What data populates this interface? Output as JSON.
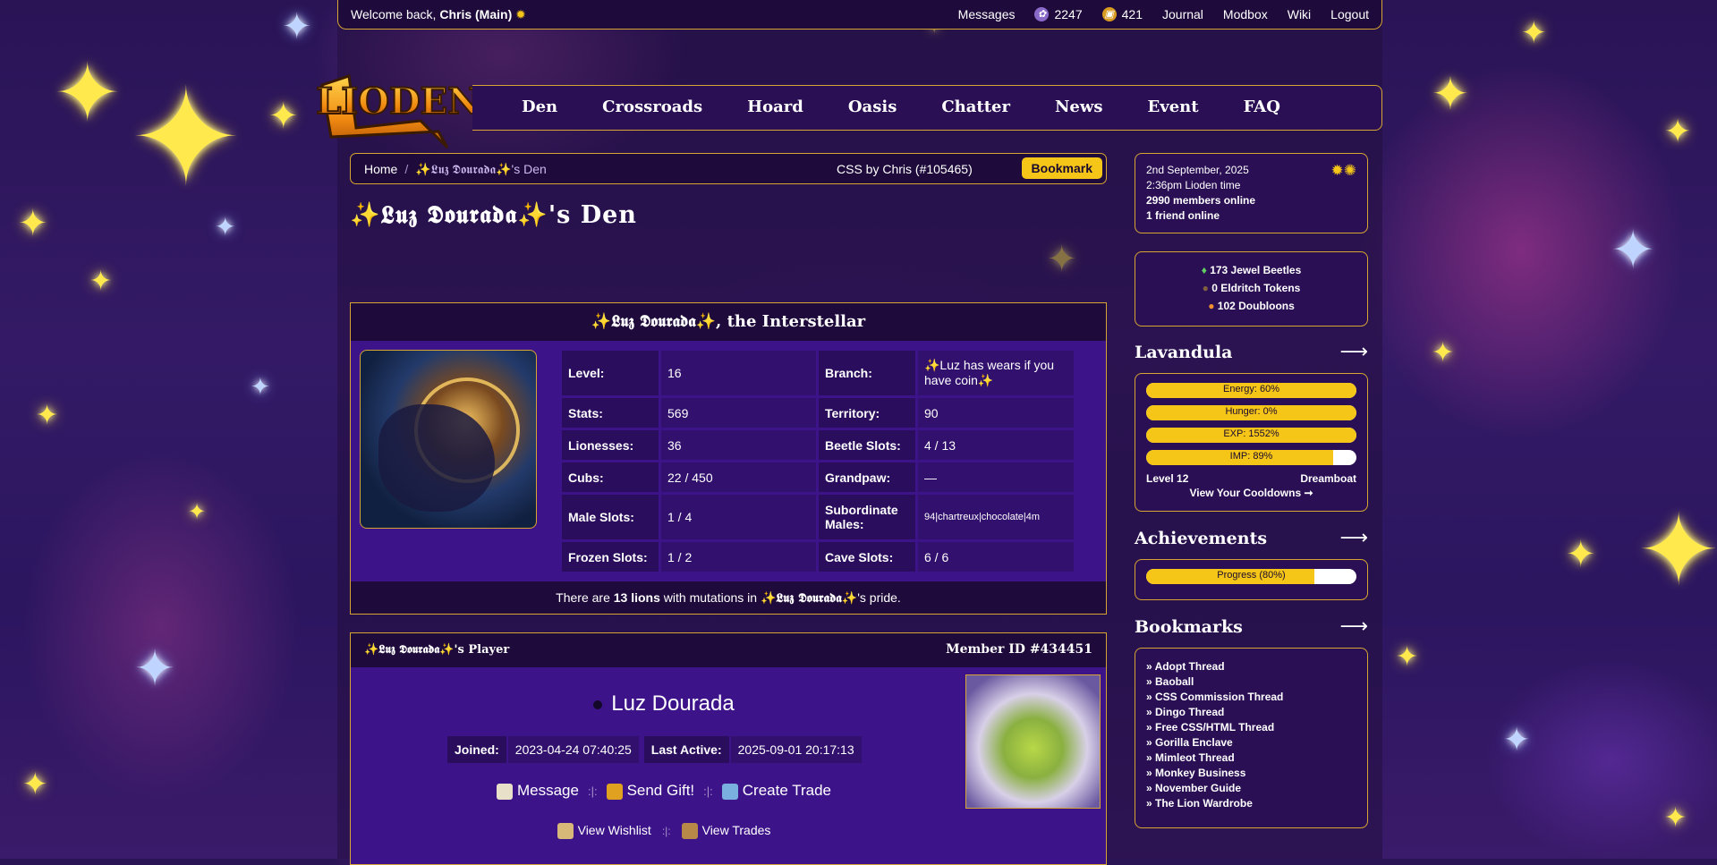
{
  "topbar": {
    "welcome_prefix": "Welcome back, ",
    "user": "Chris (Main)",
    "nav": {
      "messages": "Messages",
      "beetles_count": "2247",
      "gifts_count": "421",
      "journal": "Journal",
      "modbox": "Modbox",
      "wiki": "Wiki",
      "logout": "Logout"
    }
  },
  "logo_text": "LIODEN",
  "mainnav": [
    "Den",
    "Crossroads",
    "Hoard",
    "Oasis",
    "Chatter",
    "News",
    "Event",
    "FAQ"
  ],
  "breadcrumb": {
    "home": "Home",
    "sep": "/",
    "current": "✨𝕷𝖚𝖟 𝕯𝖔𝖚𝖗𝖆𝖉𝖆✨'s Den",
    "css_credit": "CSS by Chris (#105465)",
    "bookmark": "Bookmark"
  },
  "den_title": "✨𝕷𝖚𝖟 𝕯𝖔𝖚𝖗𝖆𝖉𝖆✨'s Den",
  "lion": {
    "heading": "✨𝕷𝖚𝖟 𝕯𝖔𝖚𝖗𝖆𝖉𝖆✨, the Interstellar",
    "rows": [
      {
        "k1": "Level:",
        "v1": "16",
        "k2": "Branch:",
        "v2": "✨Luz has wears if you have coin✨"
      },
      {
        "k1": "Stats:",
        "v1": "569",
        "k2": "Territory:",
        "v2": "90"
      },
      {
        "k1": "Lionesses:",
        "v1": "36",
        "k2": "Beetle Slots:",
        "v2": "4 / 13"
      },
      {
        "k1": "Cubs:",
        "v1": "22 / 450",
        "k2": "Grandpaw:",
        "v2": "—"
      },
      {
        "k1": "Male Slots:",
        "v1": "1 / 4",
        "k2": "Subordinate Males:",
        "v2": "94|chartreux|chocolate|4m"
      },
      {
        "k1": "Frozen Slots:",
        "v1": "1 / 2",
        "k2": "Cave Slots:",
        "v2": "6 / 6"
      }
    ],
    "footer_pre": "There are ",
    "footer_count": "13 lions",
    "footer_mid": " with mutations in ",
    "footer_name": "✨𝕷𝖚𝖟 𝕯𝖔𝖚𝖗𝖆𝖉𝖆✨",
    "footer_post": "'s pride."
  },
  "player": {
    "heading": "✨𝕷𝖚𝖟 𝕯𝖔𝖚𝖗𝖆𝖉𝖆✨'s Player",
    "member_id_label": "Member ID",
    "member_id": "#434451",
    "name": "Luz Dourada",
    "joined_label": "Joined:",
    "joined": "2023-04-24 07:40:25",
    "active_label": "Last Active:",
    "active": "2025-09-01 20:17:13",
    "actions": [
      "Message",
      "Send Gift!",
      "Create Trade"
    ],
    "actions_sep": ":|:",
    "actions2": [
      "View Wishlist",
      "View Trades"
    ]
  },
  "sidebar": {
    "date": "2nd September, 2025",
    "time": "2:36pm Lioden time",
    "members": "2990 members online",
    "friends": "1 friend online",
    "currency": [
      "173 Jewel Beetles",
      "0 Eldritch Tokens",
      "102 Doubloons"
    ],
    "lavandula": {
      "title": "Lavandula",
      "bars": [
        {
          "label": "Energy: 60%",
          "fill": 100
        },
        {
          "label": "Hunger: 0%",
          "fill": 100
        },
        {
          "label": "EXP: 1552%",
          "fill": 100
        },
        {
          "label": "IMP: 89%",
          "fill": 89
        }
      ],
      "level": "Level 12",
      "location": "Dreamboat",
      "cooldowns": "View Your Cooldowns ➞"
    },
    "achievements": {
      "title": "Achievements",
      "progress_label": "Progress (80%)",
      "progress": 80
    },
    "bookmarks": {
      "title": "Bookmarks",
      "items": [
        "» Adopt Thread",
        "» Baoball",
        "» CSS Commission Thread",
        "» Dingo Thread",
        "» Free CSS/HTML Thread",
        "» Gorilla Enclave",
        "» Mimleot Thread",
        "» Monkey Business",
        "» November Guide",
        "» The Lion Wardrobe"
      ]
    },
    "arrow": "⟶"
  },
  "colors": {
    "accent": "#f5c518",
    "border": "#d7a531",
    "panel": "#3d138a",
    "dark": "#1e0b3b"
  }
}
